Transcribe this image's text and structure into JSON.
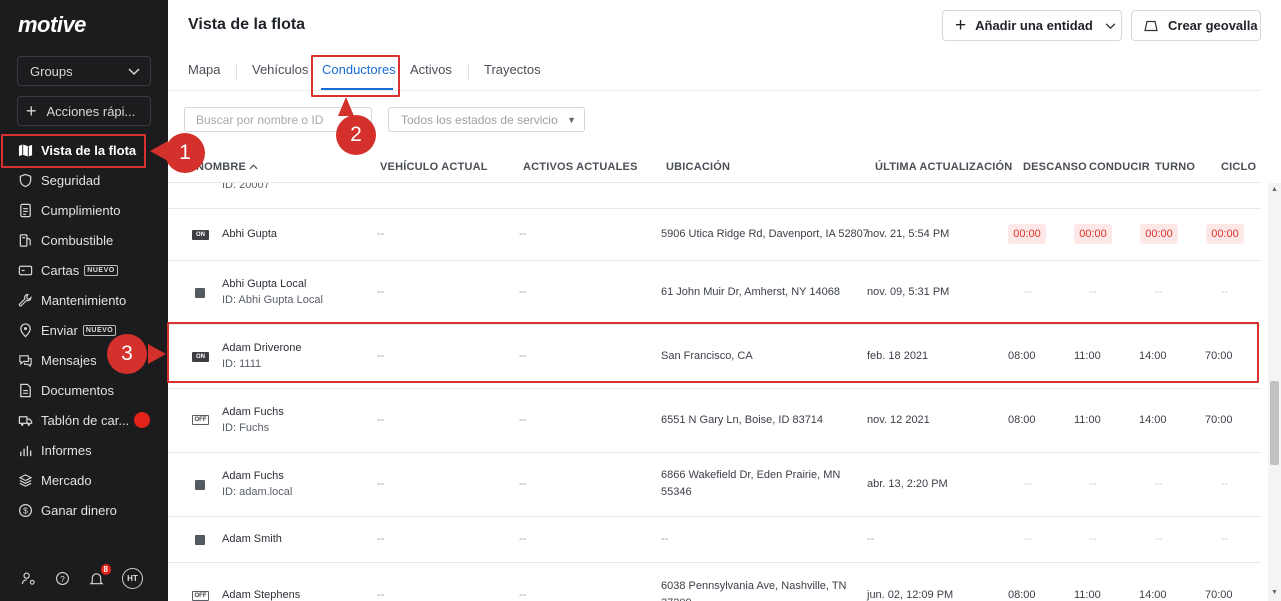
{
  "sidebar": {
    "logo": "motive",
    "groups_label": "Groups",
    "quick_actions_label": "Acciones rápi...",
    "items": [
      {
        "label": "Vista de la flota",
        "icon": "map-icon",
        "active": true
      },
      {
        "label": "Seguridad",
        "icon": "shield-icon"
      },
      {
        "label": "Cumplimiento",
        "icon": "document-check-icon"
      },
      {
        "label": "Combustible",
        "icon": "fuel-pump-icon"
      },
      {
        "label": "Cartas",
        "icon": "card-icon",
        "badge": "NUEVO"
      },
      {
        "label": "Mantenimiento",
        "icon": "wrench-icon"
      },
      {
        "label": "Enviar",
        "icon": "location-pin-icon",
        "badge": "NUEVO"
      },
      {
        "label": "Mensajes",
        "icon": "chat-icon"
      },
      {
        "label": "Documentos",
        "icon": "document-icon"
      },
      {
        "label": "Tablón de car...",
        "icon": "truck-board-icon"
      },
      {
        "label": "Informes",
        "icon": "bar-chart-icon"
      },
      {
        "label": "Mercado",
        "icon": "layers-icon"
      },
      {
        "label": "Ganar dinero",
        "icon": "dollar-circle-icon"
      }
    ],
    "notification_count": "8",
    "avatar_initials": "HT"
  },
  "header": {
    "title": "Vista de la flota",
    "add_entity_label": "Añadir una entidad",
    "geofence_label": "Crear geovalla"
  },
  "tabs": [
    {
      "label": "Mapa"
    },
    {
      "label": "Vehículos"
    },
    {
      "label": "Conductores",
      "active": true
    },
    {
      "label": "Activos"
    },
    {
      "label": "Trayectos"
    }
  ],
  "filters": {
    "search_placeholder": "Buscar por nombre o ID",
    "status_label": "Todos los estados de servicio"
  },
  "table": {
    "columns": [
      "NOMBRE",
      "VEHÍCULO ACTUAL",
      "ACTIVOS ACTUALES",
      "UBICACIÓN",
      "ÚLTIMA ACTUALIZACIÓN",
      "DESCANSO",
      "CONDUCIR",
      "TURNO",
      "CICLO"
    ],
    "partial_row_id": "ID: 20007",
    "rows": [
      {
        "status": "ON",
        "name": "Abhi Gupta",
        "id": "",
        "vehicle": "--",
        "assets": "--",
        "location": "5906 Utica Ridge Rd, Davenport, IA 52807",
        "location2": "",
        "updated": "nov. 21, 5:54 PM",
        "rest": "00:00",
        "drive": "00:00",
        "shift": "00:00",
        "cycle": "00:00",
        "violation": true
      },
      {
        "status": "SQ",
        "name": "Abhi Gupta Local",
        "id": "ID: Abhi Gupta Local",
        "vehicle": "--",
        "assets": "--",
        "location": "61 John Muir Dr, Amherst, NY 14068",
        "location2": "",
        "updated": "nov. 09, 5:31 PM",
        "rest": "--",
        "drive": "--",
        "shift": "--",
        "cycle": "--"
      },
      {
        "status": "ON",
        "name": "Adam Driverone",
        "id": "ID: 1111",
        "vehicle": "--",
        "assets": "--",
        "location": "San Francisco, CA",
        "location2": "",
        "updated": "feb. 18 2021",
        "rest": "08:00",
        "drive": "11:00",
        "shift": "14:00",
        "cycle": "70:00"
      },
      {
        "status": "OFF",
        "name": "Adam Fuchs",
        "id": "ID: Fuchs",
        "vehicle": "--",
        "assets": "--",
        "location": "6551 N Gary Ln, Boise, ID 83714",
        "location2": "",
        "updated": "nov. 12 2021",
        "rest": "08:00",
        "drive": "11:00",
        "shift": "14:00",
        "cycle": "70:00"
      },
      {
        "status": "SQ",
        "name": "Adam Fuchs",
        "id": "ID: adam.local",
        "vehicle": "--",
        "assets": "--",
        "location": "6866 Wakefield Dr, Eden Prairie, MN",
        "location2": "55346",
        "updated": "abr. 13, 2:20 PM",
        "rest": "--",
        "drive": "--",
        "shift": "--",
        "cycle": "--"
      },
      {
        "status": "SQ",
        "name": "Adam Smith",
        "id": "",
        "vehicle": "--",
        "assets": "--",
        "location": "--",
        "location2": "",
        "updated": "--",
        "rest": "--",
        "drive": "--",
        "shift": "--",
        "cycle": "--"
      },
      {
        "status": "OFF",
        "name": "Adam Stephens",
        "id": "",
        "vehicle": "--",
        "assets": "--",
        "location": "6038 Pennsylvania Ave, Nashville, TN",
        "location2": "37209",
        "updated": "jun. 02, 12:09 PM",
        "rest": "08:00",
        "drive": "11:00",
        "shift": "14:00",
        "cycle": "70:00"
      }
    ]
  },
  "annotations": [
    "1",
    "2",
    "3"
  ],
  "colors": {
    "accent": "#1a6ad6",
    "highlight": "#d8312f",
    "sidebar": "#1c1c1e",
    "violation_bg": "#fde8e7",
    "violation_text": "#d9342b"
  }
}
